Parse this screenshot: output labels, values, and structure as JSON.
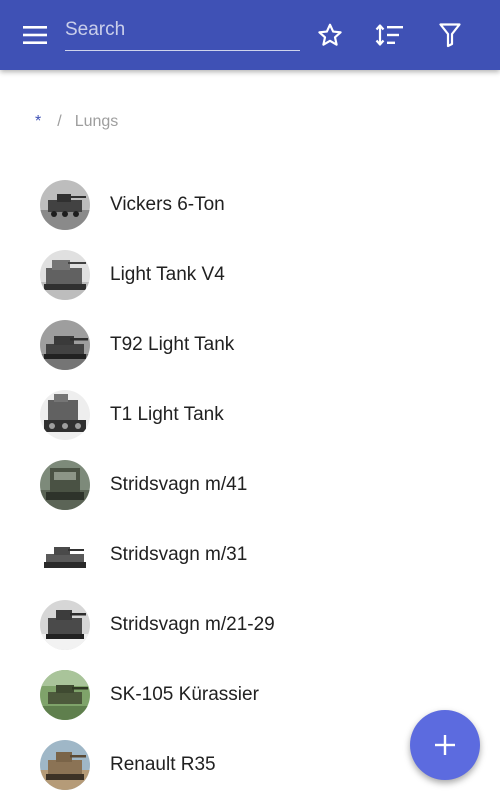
{
  "toolbar": {
    "search_placeholder": "Search",
    "icons": [
      "menu-icon",
      "star-icon",
      "sort-icon",
      "filter-icon"
    ],
    "background_color": "#3f51b5"
  },
  "breadcrumb": {
    "root": "*",
    "separator": "/",
    "current": "Lungs"
  },
  "items": [
    {
      "label": "Vickers 6-Ton"
    },
    {
      "label": "Light Tank V4"
    },
    {
      "label": "T92 Light Tank"
    },
    {
      "label": "T1 Light Tank"
    },
    {
      "label": "Stridsvagn m/41"
    },
    {
      "label": "Stridsvagn m/31"
    },
    {
      "label": "Stridsvagn m/21-29"
    },
    {
      "label": "SK-105 Kürassier"
    },
    {
      "label": "Renault R35"
    }
  ],
  "fab": {
    "icon": "plus-icon",
    "color": "#5c6bdf"
  }
}
